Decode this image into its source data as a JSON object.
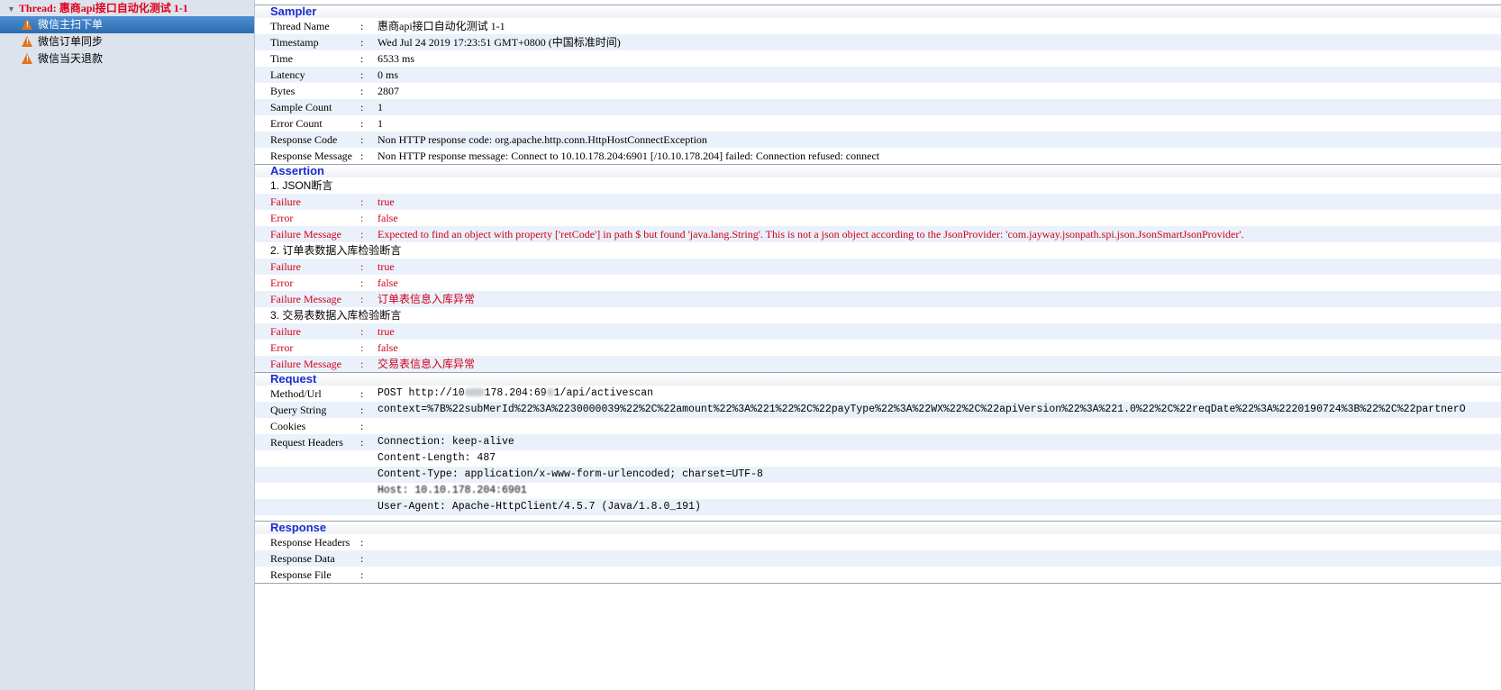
{
  "tree": {
    "root": "Thread: 惠商api接口自动化测试 1-1",
    "items": [
      {
        "label": "微信主扫下单"
      },
      {
        "label": "微信订单同步"
      },
      {
        "label": "微信当天退款"
      }
    ]
  },
  "sampler": {
    "title": "Sampler",
    "rows": [
      {
        "label": "Thread Name",
        "value": "惠商api接口自动化测试 1-1"
      },
      {
        "label": "Timestamp",
        "value": "Wed Jul 24 2019 17:23:51 GMT+0800 (中国标准时间)"
      },
      {
        "label": "Time",
        "value": "6533 ms"
      },
      {
        "label": "Latency",
        "value": "0 ms"
      },
      {
        "label": "Bytes",
        "value": "2807"
      },
      {
        "label": "Sample Count",
        "value": "1"
      },
      {
        "label": "Error Count",
        "value": "1"
      },
      {
        "label": "Response Code",
        "value": "Non HTTP response code: org.apache.http.conn.HttpHostConnectException"
      },
      {
        "label": "Response Message",
        "value": "Non HTTP response message: Connect to 10.10.178.204:6901 [/10.10.178.204] failed: Connection refused: connect"
      }
    ]
  },
  "assertion": {
    "title": "Assertion",
    "groups": [
      {
        "name": "1. JSON断言",
        "failure_label": "Failure",
        "failure": "true",
        "error_label": "Error",
        "error": "false",
        "message_label": "Failure Message",
        "message": "Expected to find an object with property ['retCode'] in path $ but found 'java.lang.String'. This is not a json object according to the JsonProvider: 'com.jayway.jsonpath.spi.json.JsonSmartJsonProvider'."
      },
      {
        "name": "2. 订单表数据入库检验断言",
        "failure_label": "Failure",
        "failure": "true",
        "error_label": "Error",
        "error": "false",
        "message_label": "Failure Message",
        "message": "订单表信息入库异常"
      },
      {
        "name": "3. 交易表数据入库检验断言",
        "failure_label": "Failure",
        "failure": "true",
        "error_label": "Error",
        "error": "false",
        "message_label": "Failure Message",
        "message": "交易表信息入库异常"
      }
    ]
  },
  "request": {
    "title": "Request",
    "method_label": "Method/Url",
    "method_prefix": "POST http://10",
    "method_mid": "178.204:69",
    "method_suffix": "1/api/activescan",
    "query_label": "Query String",
    "query": "context=%7B%22subMerId%22%3A%2230000039%22%2C%22amount%22%3A%221%22%2C%22payType%22%3A%22WX%22%2C%22apiVersion%22%3A%221.0%22%2C%22reqDate%22%3A%2220190724%3B%22%2C%22partnerO",
    "cookies_label": "Cookies",
    "headers_label": "Request Headers",
    "headers": [
      "Connection: keep-alive",
      "Content-Length: 487",
      "Content-Type: application/x-www-form-urlencoded; charset=UTF-8",
      "Host: 10.10.178.204:6901",
      "User-Agent: Apache-HttpClient/4.5.7 (Java/1.8.0_191)"
    ]
  },
  "response": {
    "title": "Response",
    "rows": [
      {
        "label": "Response Headers",
        "value": ""
      },
      {
        "label": "Response Data",
        "value": ""
      },
      {
        "label": "Response File",
        "value": ""
      }
    ]
  },
  "colon": ":"
}
